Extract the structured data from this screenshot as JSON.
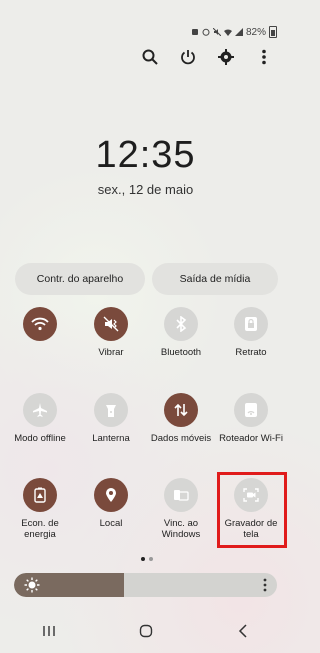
{
  "status": {
    "battery_text": "82%"
  },
  "clock": {
    "time": "12:35",
    "date": "sex., 12 de maio"
  },
  "pills": {
    "device_control": "Contr. do aparelho",
    "media_output": "Saída de mídia"
  },
  "tiles": [
    {
      "label": "",
      "icon": "wifi-icon",
      "state": "on"
    },
    {
      "label": "Vibrar",
      "icon": "vibrate-icon",
      "state": "on"
    },
    {
      "label": "Bluetooth",
      "icon": "bluetooth-icon",
      "state": "off"
    },
    {
      "label": "Retrato",
      "icon": "portrait-lock-icon",
      "state": "off"
    },
    {
      "label": "Modo offline",
      "icon": "airplane-icon",
      "state": "off"
    },
    {
      "label": "Lanterna",
      "icon": "flashlight-icon",
      "state": "off"
    },
    {
      "label": "Dados móveis",
      "icon": "mobile-data-icon",
      "state": "on"
    },
    {
      "label": "Roteador Wi-Fi",
      "icon": "hotspot-icon",
      "state": "off"
    },
    {
      "label": "Econ. de energia",
      "icon": "power-saving-icon",
      "state": "on"
    },
    {
      "label": "Local",
      "icon": "location-icon",
      "state": "on"
    },
    {
      "label": "Vinc. ao Windows",
      "icon": "link-windows-icon",
      "state": "off"
    },
    {
      "label": "Gravador de tela",
      "icon": "screen-recorder-icon",
      "state": "off"
    }
  ],
  "brightness": {
    "level": 0.42
  },
  "colors": {
    "accent": "#7a4a3c",
    "highlight": "#e01b1b"
  }
}
